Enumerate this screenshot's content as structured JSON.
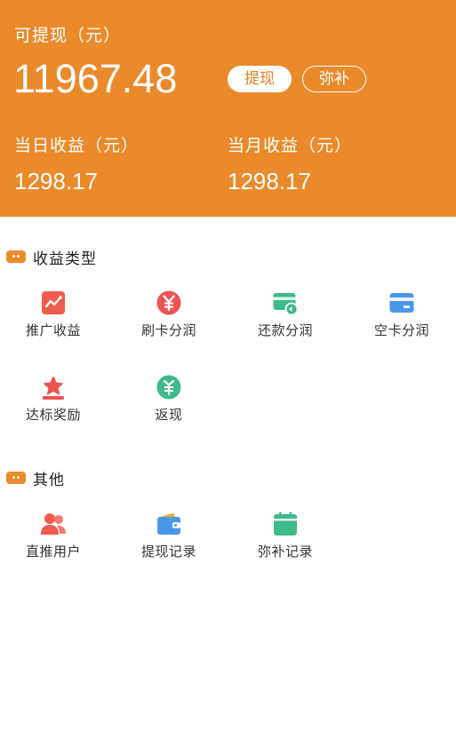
{
  "header": {
    "balance_label": "可提现（元）",
    "balance": "11967.48",
    "withdraw_button": "提现",
    "supplement_button": "弥补",
    "today_label": "当日收益（元）",
    "today_value": "1298.17",
    "month_label": "当月收益（元）",
    "month_value": "1298.17",
    "background_color": "#ea8a2b"
  },
  "income_types": {
    "title": "收益类型",
    "items": [
      {
        "label": "推广收益",
        "icon": "trend-chart-icon"
      },
      {
        "label": "刷卡分润",
        "icon": "yen-coin-icon"
      },
      {
        "label": "还款分润",
        "icon": "card-refund-icon"
      },
      {
        "label": "空卡分润",
        "icon": "credit-card-icon"
      },
      {
        "label": "达标奖励",
        "icon": "star-trophy-icon"
      },
      {
        "label": "返现",
        "icon": "cashback-coin-icon"
      }
    ]
  },
  "others": {
    "title": "其他",
    "items": [
      {
        "label": "直推用户",
        "icon": "users-icon"
      },
      {
        "label": "提现记录",
        "icon": "wallet-icon"
      },
      {
        "label": "弥补记录",
        "icon": "calendar-icon"
      }
    ]
  }
}
